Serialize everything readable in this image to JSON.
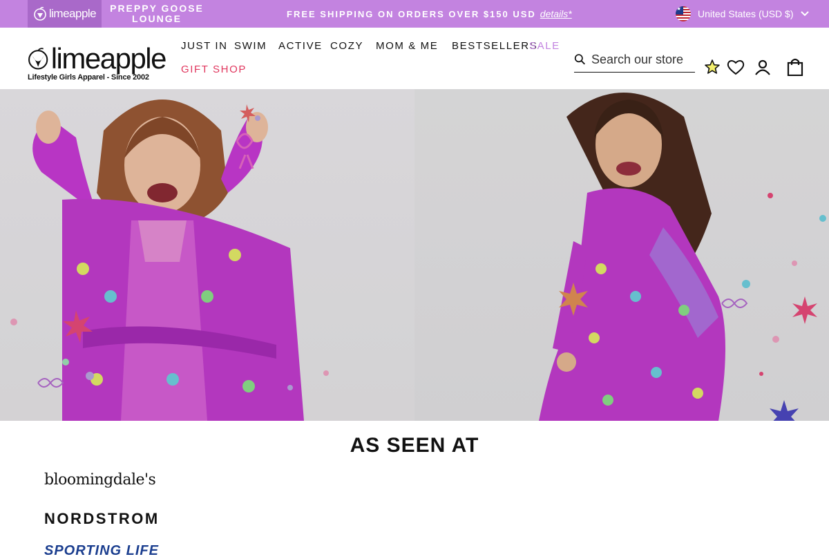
{
  "topbar": {
    "brand_limeapple": "limeapple",
    "brand_preppy_line1": "PREPPY GOOSE",
    "brand_preppy_line2": "LOUNGE",
    "announcement": "FREE SHIPPING ON ORDERS OVER $150 USD",
    "details_link": "details*",
    "country_selector": "United States (USD $)",
    "colors": {
      "bar": "#c383e0",
      "active_tab": "#a969c9"
    }
  },
  "header": {
    "logo_word": "limeapple",
    "logo_tagline": "Lifestyle Girls Apparel - Since 2002",
    "nav": [
      {
        "label": "JUST IN"
      },
      {
        "label": "SWIM"
      },
      {
        "label": "ACTIVE"
      },
      {
        "label": "COZY"
      },
      {
        "label": "MOM & ME"
      },
      {
        "label": "BESTSELLERS"
      },
      {
        "label": "SALE",
        "color": "#c383e0"
      },
      {
        "label": "GIFT SHOP",
        "color": "#e0355d"
      }
    ],
    "search_placeholder": "Search our store",
    "icons": [
      "search-icon",
      "star-icon",
      "heart-icon",
      "account-icon",
      "cart-icon"
    ]
  },
  "hero": {
    "robe_color": "#b030c8"
  },
  "as_seen_at": {
    "title": "AS SEEN AT",
    "retailers": [
      "bloomingdale's",
      "NORDSTROM",
      "SPORTING LIFE"
    ]
  }
}
